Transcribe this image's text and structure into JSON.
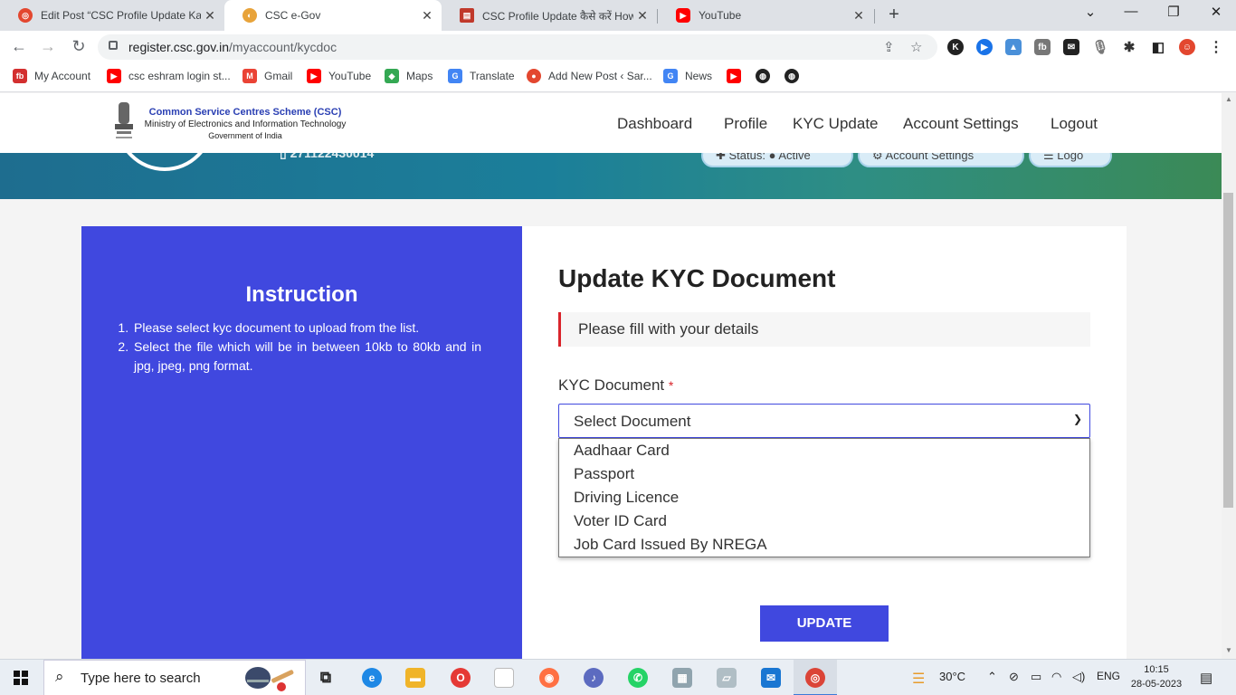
{
  "browser": {
    "tabs": [
      {
        "title": "Edit Post “CSC Profile Update Ka",
        "favicon_color": "#e3472f"
      },
      {
        "title": "CSC e-Gov",
        "favicon_color": "#e8a33a"
      },
      {
        "title": "CSC Profile Update कैसे करें How",
        "favicon_color": "#c0392b"
      },
      {
        "title": "YouTube",
        "favicon_color": "#ff0000"
      }
    ],
    "active_tab_index": 1,
    "url_host": "register.csc.gov.in",
    "url_path": "/myaccount/kycdoc",
    "bookmarks": [
      {
        "label": "My Account",
        "color": "#d32f2f",
        "glyph": "fb"
      },
      {
        "label": "csc eshram login st...",
        "color": "#ff0000",
        "glyph": "▶"
      },
      {
        "label": "Gmail",
        "color": "#ea4335",
        "glyph": "M"
      },
      {
        "label": "YouTube",
        "color": "#ff0000",
        "glyph": "▶"
      },
      {
        "label": "Maps",
        "color": "#34a853",
        "glyph": "◆"
      },
      {
        "label": "Translate",
        "color": "#4285f4",
        "glyph": "G"
      },
      {
        "label": "Add New Post ‹ Sar...",
        "color": "#e3472f",
        "glyph": "●"
      },
      {
        "label": "News",
        "color": "#4285f4",
        "glyph": "G"
      }
    ]
  },
  "site": {
    "logo": {
      "line1": "Common Service Centres Scheme (CSC)",
      "line2": "Ministry of Electronics and Information Technology",
      "line3": "Government of India"
    },
    "nav": [
      "Dashboard",
      "Profile",
      "KYC Update",
      "Account Settings",
      "Logout"
    ],
    "banner": {
      "mobile": "▯ 271122430014",
      "pills": [
        "✚ Status: ● Active",
        "⚙ Account Settings",
        "☰ Logo"
      ]
    }
  },
  "instruction": {
    "title": "Instruction",
    "items": [
      "Please select kyc document to upload from the list.",
      "Select the file which will be in between 10kb to 80kb and in jpg, jpeg, png format."
    ]
  },
  "form": {
    "title": "Update KYC Document",
    "notice": "Please fill with your details",
    "field_label": "KYC Document",
    "required_mark": "*",
    "select_placeholder": "Select Document",
    "options": [
      "Aadhaar Card",
      "Passport",
      "Driving Licence",
      "Voter ID Card",
      "Job Card Issued By NREGA"
    ],
    "submit_label": "UPDATE"
  },
  "colors": {
    "accent": "#4048df",
    "required": "#d9242b",
    "banner_start": "#1e6d8f",
    "banner_end": "#3b8a56"
  },
  "taskbar": {
    "search_placeholder": "Type here to search",
    "weather": "30°C",
    "language": "ENG",
    "time": "10:15",
    "date": "28-05-2023"
  }
}
